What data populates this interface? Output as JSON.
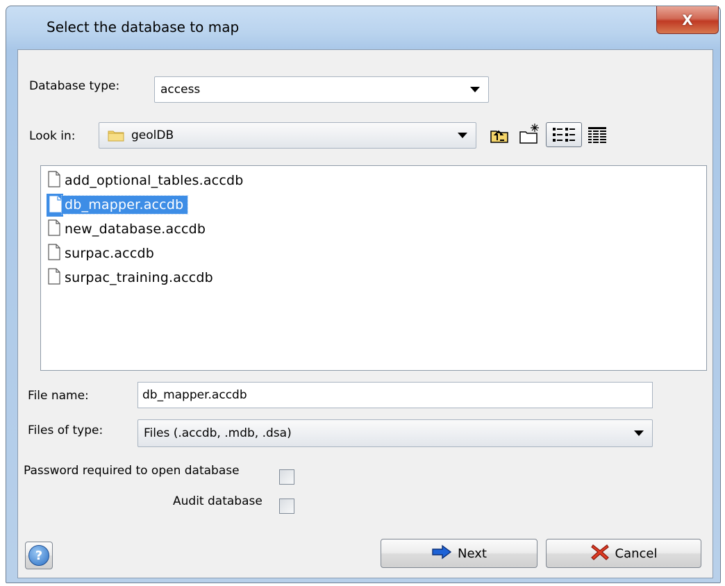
{
  "window": {
    "title": "Select the database to map",
    "close_label": "X"
  },
  "database_type": {
    "label": "Database type:",
    "value": "access"
  },
  "look_in": {
    "label": "Look in:",
    "value": "geolDB",
    "tools": [
      "up-one-level-icon",
      "create-new-folder-icon",
      "list-view-icon",
      "details-view-icon"
    ]
  },
  "files": [
    {
      "name": "add_optional_tables.accdb",
      "selected": false
    },
    {
      "name": "db_mapper.accdb",
      "selected": true
    },
    {
      "name": "new_database.accdb",
      "selected": false
    },
    {
      "name": "surpac.accdb",
      "selected": false
    },
    {
      "name": "surpac_training.accdb",
      "selected": false
    }
  ],
  "file_name": {
    "label": "File name:",
    "value": "db_mapper.accdb"
  },
  "files_of_type": {
    "label": "Files of type:",
    "value": "Files (.accdb, .mdb, .dsa)"
  },
  "options": {
    "password_label": "Password required to open database",
    "password_checked": false,
    "audit_label": "Audit database",
    "audit_checked": false
  },
  "buttons": {
    "help_label": "?",
    "next_label": "Next",
    "cancel_label": "Cancel"
  },
  "colors": {
    "selection": "#3d8de6",
    "title_bar": "#b9d3ee",
    "close": "#c03a24"
  }
}
